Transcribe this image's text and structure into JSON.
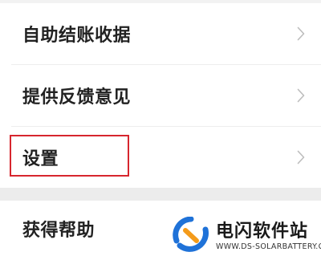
{
  "menu": {
    "items": [
      {
        "label": "自助结账收据",
        "icon": "chevron-right-icon"
      },
      {
        "label": "提供反馈意见",
        "icon": "chevron-right-icon"
      },
      {
        "label": "设置",
        "icon": "chevron-right-icon",
        "highlighted": true
      }
    ],
    "bottom_item": {
      "label": "获得帮助"
    }
  },
  "watermark": {
    "title": "电闪软件站",
    "url": "WWW.DS-SOLARBATTERY.COM",
    "logo_icon": "lightning-logo-icon"
  },
  "colors": {
    "highlight": "#d7262e",
    "chevron": "#bdbdbd",
    "logo_blue": "#1f72d8",
    "logo_orange": "#f49b1a"
  }
}
